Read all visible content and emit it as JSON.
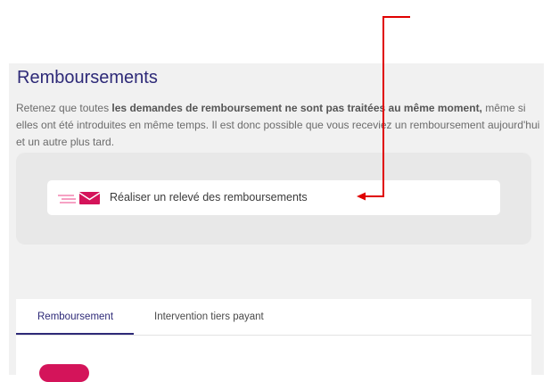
{
  "page": {
    "title": "Remboursements",
    "description_part1": "Retenez que toutes ",
    "description_bold": "les demandes de remboursement ne sont pas traitées au même moment,",
    "description_part2": " même si elles ont été introduites en même temps. Il est donc possible que vous receviez un remboursement aujourd'hui et un autre plus tard."
  },
  "action": {
    "label": "Réaliser un relevé des remboursements",
    "icon": "email-icon"
  },
  "tabs": [
    {
      "label": "Remboursement",
      "active": true
    },
    {
      "label": "Intervention tiers payant",
      "active": false
    }
  ],
  "colors": {
    "brand": "#2e2a78",
    "accent": "#d4145a",
    "annotation": "#e00000"
  }
}
